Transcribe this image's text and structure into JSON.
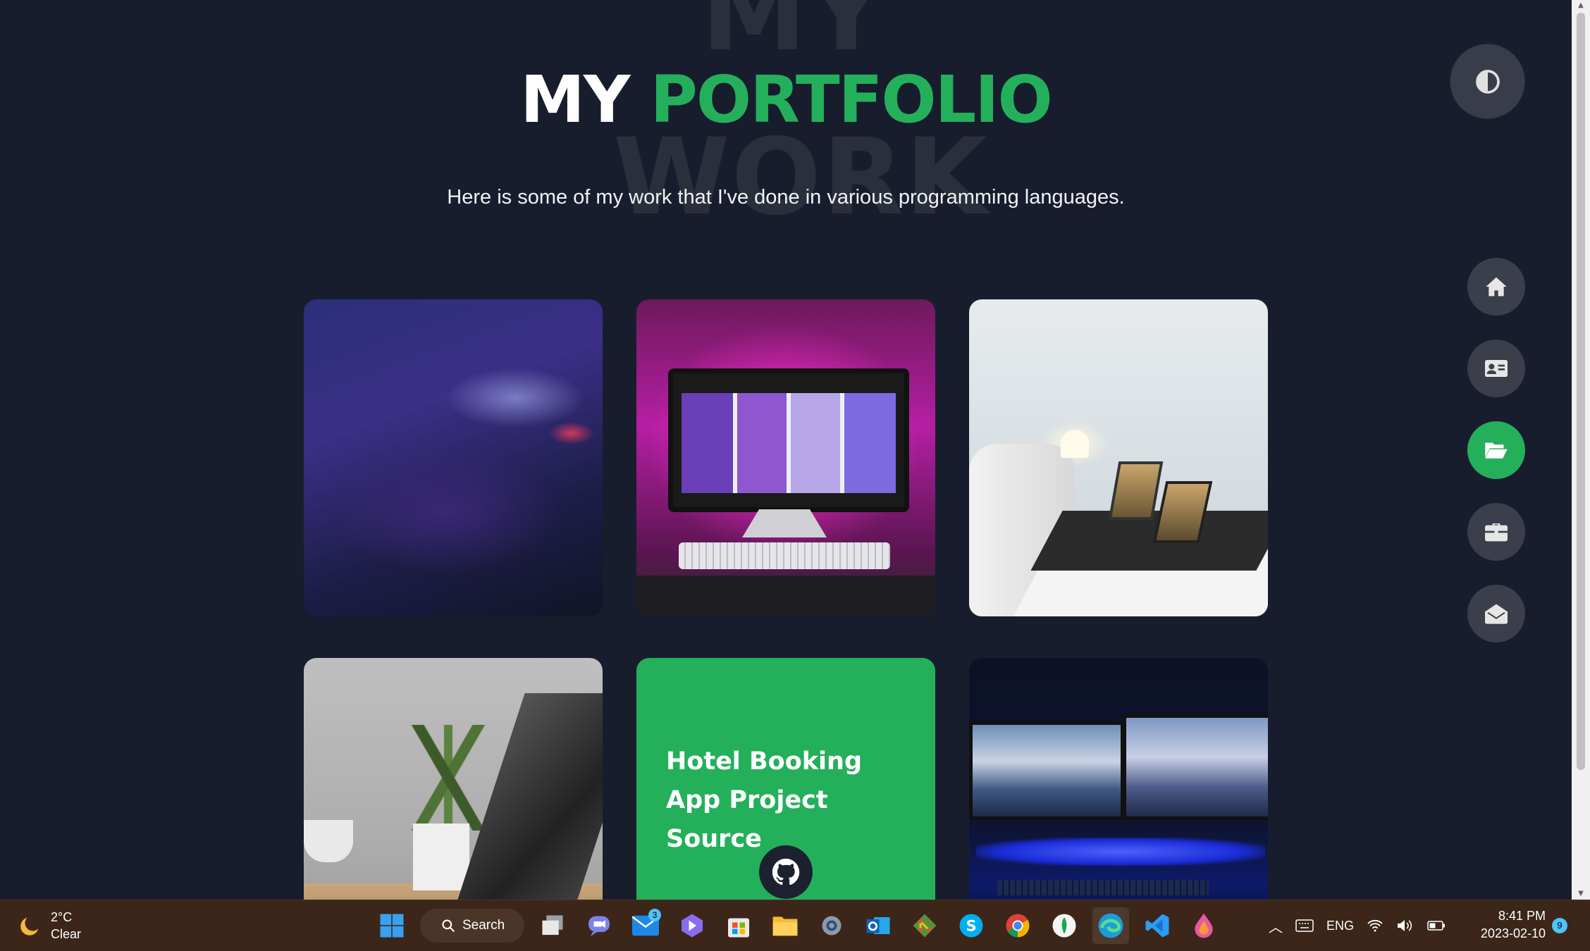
{
  "hero": {
    "bg_word_1": "MY",
    "bg_word_2": "WORK",
    "title_white": "MY",
    "title_green": "PORTFOLIO",
    "subtitle": "Here is some of my work that I've done in various programming languages."
  },
  "colors": {
    "background": "#181d2e",
    "accent": "#24b05b",
    "nav_button": "#3a3f4b"
  },
  "portfolio": {
    "cards": [
      {
        "kind": "image",
        "image": "hand on illuminated keyboard"
      },
      {
        "kind": "image",
        "image": "desktop computer with magenta backlight"
      },
      {
        "kind": "image",
        "image": "white desk with laptops and lamp"
      },
      {
        "kind": "image",
        "image": "plant beside laptop"
      },
      {
        "kind": "project",
        "title": "Hotel Booking App Project Source",
        "icon": "github-icon"
      },
      {
        "kind": "image",
        "image": "dual monitors with blue glow"
      }
    ]
  },
  "nav": {
    "theme_toggle_icon": "contrast-icon",
    "items": [
      {
        "icon": "home-icon",
        "active": false
      },
      {
        "icon": "id-card-icon",
        "active": false
      },
      {
        "icon": "folder-open-icon",
        "active": true
      },
      {
        "icon": "briefcase-icon",
        "active": false
      },
      {
        "icon": "envelope-open-icon",
        "active": false
      }
    ]
  },
  "taskbar": {
    "weather": {
      "temp": "2°C",
      "condition": "Clear",
      "icon": "moon-icon"
    },
    "search_label": "Search",
    "mail_badge": "3",
    "apps": [
      "windows-start-icon",
      "search-icon",
      "task-view-icon",
      "teams-chat-icon",
      "mail-icon",
      "copilot-icon",
      "store-icon",
      "file-explorer-icon",
      "settings-icon",
      "outlook-icon",
      "git-icon",
      "skype-icon",
      "chrome-icon",
      "mongodb-compass-icon",
      "edge-icon",
      "vscode-icon",
      "paint-drop-icon"
    ],
    "tray": {
      "language": "ENG"
    },
    "clock": {
      "time": "8:41 PM",
      "date": "2023-02-10"
    },
    "notifications": "9"
  }
}
